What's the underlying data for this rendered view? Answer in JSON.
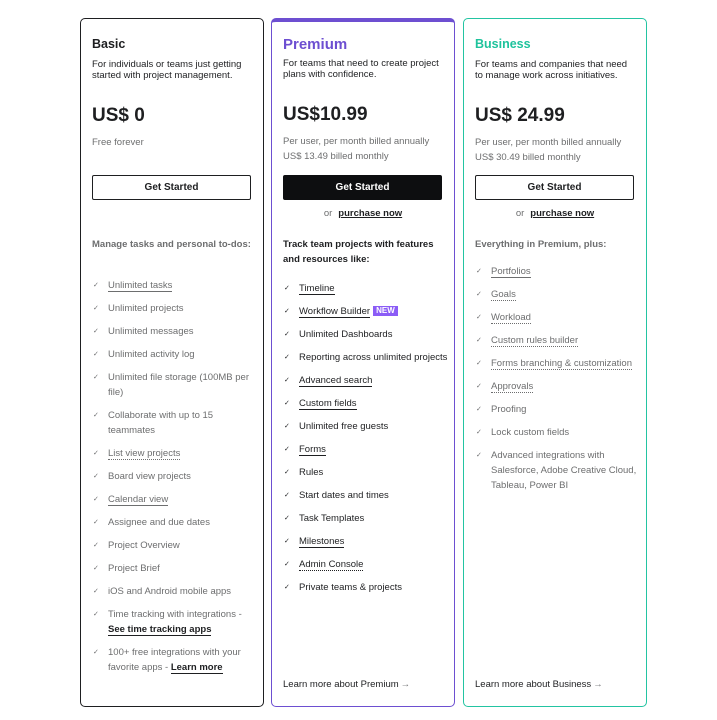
{
  "plans": [
    {
      "id": "basic",
      "name": "Basic",
      "description": "For individuals or teams just getting started with project management.",
      "price": "US$ 0",
      "price_note_1": "Free forever",
      "price_note_2": "",
      "cta_label": "Get Started",
      "features_intro": "Manage tasks and personal to-dos:",
      "features": [
        {
          "text": "Unlimited tasks",
          "underline": "solid"
        },
        {
          "text": "Unlimited projects",
          "underline": "none"
        },
        {
          "text": "Unlimited messages",
          "underline": "none"
        },
        {
          "text": "Unlimited activity log",
          "underline": "none"
        },
        {
          "text": "Unlimited file storage (100MB per file)",
          "underline": "none"
        },
        {
          "text": "Collaborate with up to 15 teammates",
          "underline": "none"
        },
        {
          "text": "List view projects",
          "underline": "dotted"
        },
        {
          "text": "Board view projects",
          "underline": "none"
        },
        {
          "text": "Calendar view",
          "underline": "solid"
        },
        {
          "text": "Assignee and due dates",
          "underline": "none"
        },
        {
          "text": "Project Overview",
          "underline": "none"
        },
        {
          "text": "Project Brief",
          "underline": "none"
        },
        {
          "text": "iOS and Android mobile apps",
          "underline": "none"
        },
        {
          "text": "Time tracking with integrations - ",
          "underline": "none",
          "link": "See time tracking apps"
        },
        {
          "text": "100+ free integrations with your favorite apps - ",
          "underline": "none",
          "link": "Learn more"
        }
      ]
    },
    {
      "id": "premium",
      "name": "Premium",
      "description": "For teams that need to create project plans with confidence.",
      "price": "US$10.99",
      "price_note_1": "Per user, per month billed annually",
      "price_note_2": "US$ 13.49 billed monthly",
      "cta_label": "Get Started",
      "or_text": "or",
      "purchase_label": "purchase now",
      "features_intro": "Track team projects with features and resources like:",
      "features": [
        {
          "text": "Timeline",
          "underline": "solid"
        },
        {
          "text": "Workflow Builder",
          "underline": "solid",
          "badge": "NEW"
        },
        {
          "text": "Unlimited Dashboards",
          "underline": "none"
        },
        {
          "text": "Reporting across unlimited projects",
          "underline": "none"
        },
        {
          "text": "Advanced search",
          "underline": "solid"
        },
        {
          "text": "Custom fields",
          "underline": "solid"
        },
        {
          "text": "Unlimited free guests",
          "underline": "none"
        },
        {
          "text": "Forms",
          "underline": "solid"
        },
        {
          "text": "Rules",
          "underline": "none"
        },
        {
          "text": "Start dates and times",
          "underline": "none"
        },
        {
          "text": "Task Templates",
          "underline": "none"
        },
        {
          "text": "Milestones",
          "underline": "solid"
        },
        {
          "text": "Admin Console",
          "underline": "dotted"
        },
        {
          "text": "Private teams & projects",
          "underline": "none"
        }
      ],
      "learn_more": "Learn more about Premium"
    },
    {
      "id": "business",
      "name": "Business",
      "description": "For teams and companies that need to manage work across initiatives.",
      "price": "US$ 24.99",
      "price_note_1": "Per user, per month billed annually",
      "price_note_2": "US$ 30.49 billed monthly",
      "cta_label": "Get Started",
      "or_text": "or",
      "purchase_label": "purchase now",
      "features_intro": "Everything in Premium, plus:",
      "features": [
        {
          "text": "Portfolios",
          "underline": "solid"
        },
        {
          "text": "Goals",
          "underline": "dotted"
        },
        {
          "text": "Workload",
          "underline": "dotted"
        },
        {
          "text": "Custom rules builder",
          "underline": "dotted"
        },
        {
          "text": "Forms branching & customization",
          "underline": "dotted"
        },
        {
          "text": "Approvals",
          "underline": "dotted"
        },
        {
          "text": "Proofing",
          "underline": "none"
        },
        {
          "text": "Lock custom fields",
          "underline": "none"
        },
        {
          "text": "Advanced integrations with Salesforce, Adobe Creative Cloud, Tableau, Power BI",
          "underline": "none"
        }
      ],
      "learn_more": "Learn more about Business"
    }
  ],
  "icons": {
    "check": "✓",
    "arrow": "→"
  },
  "colors": {
    "premium_accent": "#6d4fd1",
    "business_accent": "#1ec39c",
    "new_badge": "#8b5cf6",
    "text_dark": "#1e1f21",
    "text_muted": "#6d6e6f"
  }
}
